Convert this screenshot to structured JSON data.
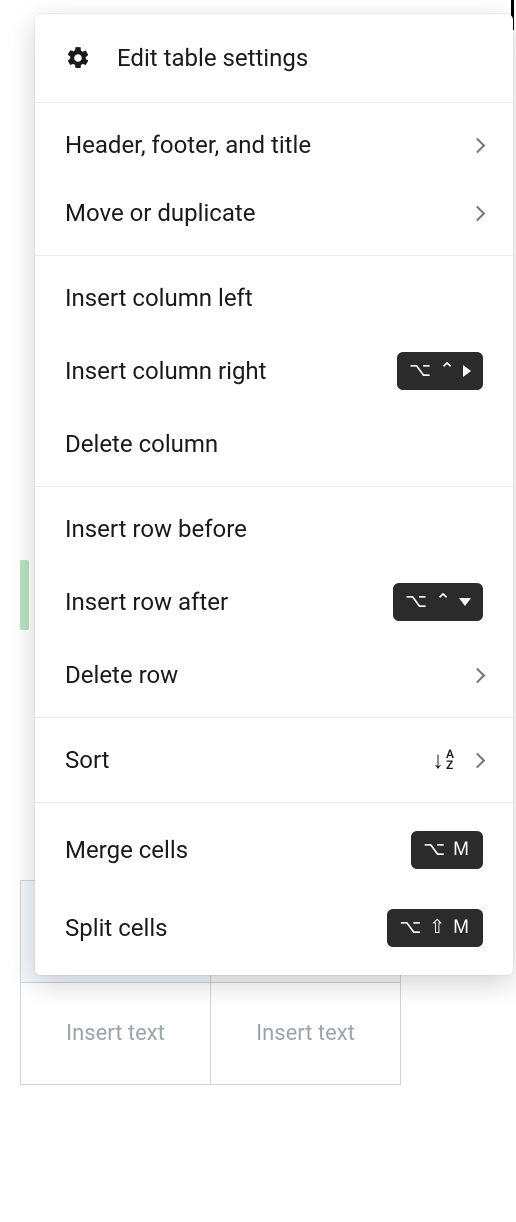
{
  "menu": {
    "title": "Edit table settings",
    "groups": [
      {
        "items": [
          {
            "key": "header-footer-title",
            "label": "Header, footer, and title",
            "submenu": true
          },
          {
            "key": "move-duplicate",
            "label": "Move or duplicate",
            "submenu": true
          }
        ]
      },
      {
        "items": [
          {
            "key": "insert-col-left",
            "label": "Insert column left"
          },
          {
            "key": "insert-col-right",
            "label": "Insert column right",
            "shortcut": {
              "opt": true,
              "ctrl": true,
              "glyph": "tri-right"
            }
          },
          {
            "key": "delete-col",
            "label": "Delete column"
          }
        ]
      },
      {
        "items": [
          {
            "key": "insert-row-before",
            "label": "Insert row before"
          },
          {
            "key": "insert-row-after",
            "label": "Insert row after",
            "shortcut": {
              "opt": true,
              "ctrl": true,
              "glyph": "tri-down"
            }
          },
          {
            "key": "delete-row",
            "label": "Delete row",
            "submenu": true
          }
        ]
      },
      {
        "items": [
          {
            "key": "sort",
            "label": "Sort",
            "sortIcon": true,
            "submenu": true
          }
        ]
      },
      {
        "items": [
          {
            "key": "merge-cells",
            "label": "Merge cells",
            "shortcut": {
              "opt": true,
              "letter": "M"
            }
          },
          {
            "key": "split-cells",
            "label": "Split cells",
            "shortcut": {
              "opt": true,
              "shift": true,
              "letter": "M"
            }
          }
        ]
      }
    ]
  },
  "bgTable": {
    "placeholder": "Insert text"
  }
}
